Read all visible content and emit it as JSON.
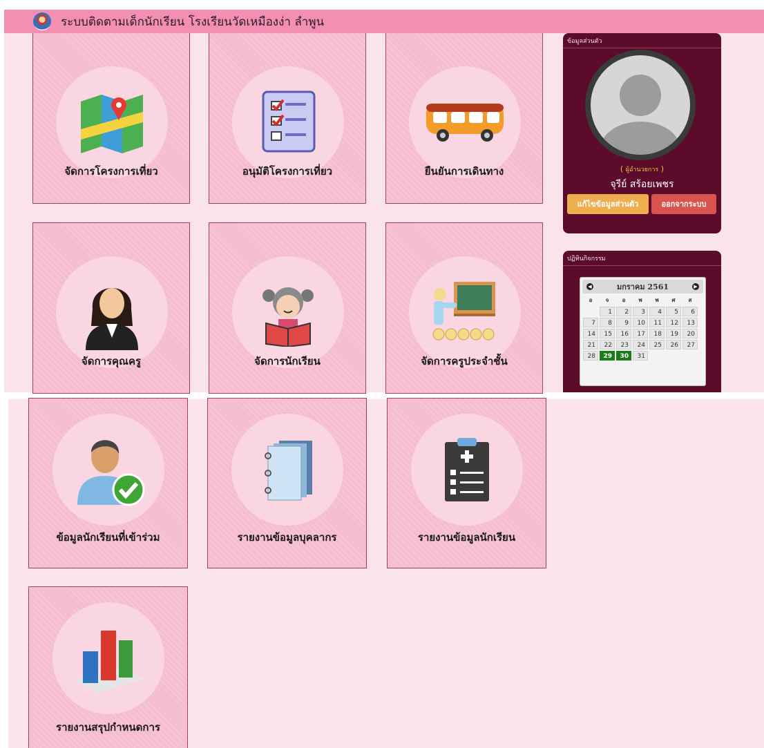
{
  "header": {
    "title": "ระบบติดตามเด็กนักเรียน โรงเรียนวัดเหมืองง่า ลำพูน"
  },
  "tiles": [
    {
      "label": "จัดการโครงการเที่ยว",
      "icon": "map-icon"
    },
    {
      "label": "อนุมัติโครงการเที่ยว",
      "icon": "checklist-document-icon"
    },
    {
      "label": "ยืนยันการเดินทาง",
      "icon": "bus-icon"
    },
    {
      "label": "จัดการคุณครู",
      "icon": "teacher-woman-icon"
    },
    {
      "label": "จัดการนักเรียน",
      "icon": "student-reading-icon"
    },
    {
      "label": "จัดการครูประจำชั้น",
      "icon": "classroom-board-icon"
    },
    {
      "label": "ข้อมูลนักเรียนที่เข้าร่วม",
      "icon": "user-check-icon"
    },
    {
      "label": "รายงานข้อมูลบุคลากร",
      "icon": "notebooks-icon"
    },
    {
      "label": "รายงานข้อมูลนักเรียน",
      "icon": "clipboard-list-icon"
    },
    {
      "label": "รายงานสรุปกำหนดการ",
      "icon": "bar-chart-icon"
    }
  ],
  "profile": {
    "heading": "ข้อมูลส่วนตัว",
    "role": "ผู้อำนวยการ",
    "name": "จุรีย์ สร้อยเพชร",
    "edit_button": "แก้ไขข้อมูลส่วนตัว",
    "logout_button": "ออกจากระบบ"
  },
  "calendar": {
    "heading": "ปฏิทินกิจกรรม",
    "month_title": "มกราคม 2561",
    "prev": "◀",
    "next": "▶",
    "weekdays": [
      "อ",
      "จ",
      "อ",
      "พ",
      "พ",
      "ศ",
      "ส"
    ],
    "leading_blanks": 1,
    "days": [
      1,
      2,
      3,
      4,
      5,
      6,
      7,
      8,
      9,
      10,
      11,
      12,
      13,
      14,
      15,
      16,
      17,
      18,
      19,
      20,
      21,
      22,
      23,
      24,
      25,
      26,
      27,
      28,
      29,
      30,
      31
    ],
    "highlighted": [
      29,
      30
    ]
  },
  "colors": {
    "topbar": "#f48fb4",
    "panel": "#5c0b2a",
    "tile": "#f5bcd2",
    "edit_btn": "#f0ad4e",
    "logout_btn": "#d9534f",
    "highlight_day": "#1d7a1d"
  }
}
